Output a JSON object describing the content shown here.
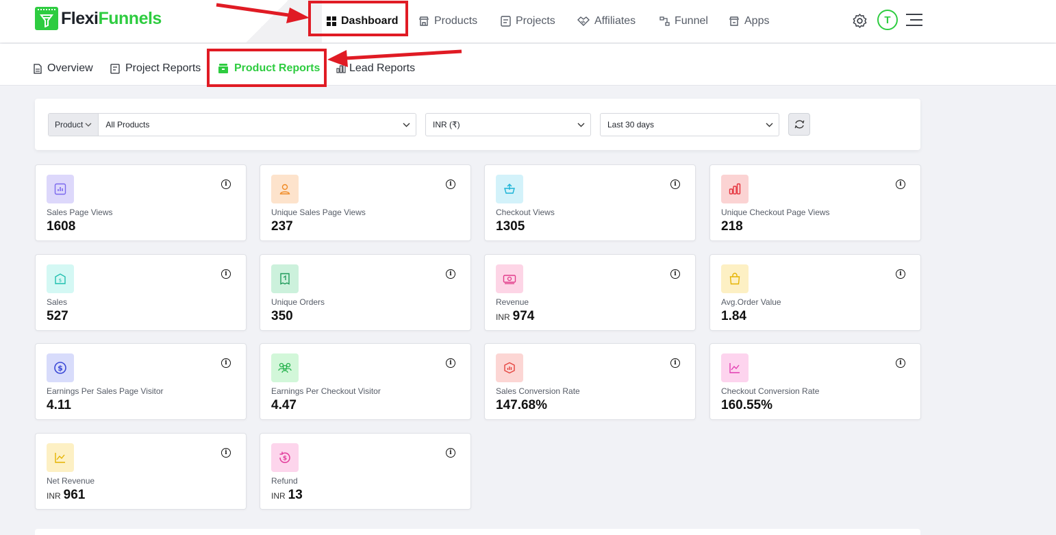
{
  "brand": {
    "name_part1": "Flexi",
    "name_part2": "Funnels"
  },
  "topnav": {
    "items": [
      {
        "label": "Dashboard",
        "icon": "grid-icon",
        "active": true
      },
      {
        "label": "Products",
        "icon": "store-icon"
      },
      {
        "label": "Projects",
        "icon": "document-icon"
      },
      {
        "label": "Affiliates",
        "icon": "handshake-icon"
      },
      {
        "label": "Funnel",
        "icon": "funnel-flow-icon"
      },
      {
        "label": "Apps",
        "icon": "apps-store-icon"
      }
    ],
    "avatar_initial": "T"
  },
  "subtabs": [
    {
      "label": "Overview",
      "icon": "file-icon"
    },
    {
      "label": "Project Reports",
      "icon": "report-icon"
    },
    {
      "label": "Product Reports",
      "icon": "product-box-icon",
      "active": true
    },
    {
      "label": "Lead Reports",
      "icon": "bar-chart-icon"
    }
  ],
  "filters": {
    "product_prefix": "Product",
    "product": "All Products",
    "currency": "INR (₹)",
    "date_range": "Last 30 days"
  },
  "metrics": [
    {
      "label": "Sales Page Views",
      "value": "1608",
      "icon": "chart-icon",
      "bg": "#ddd8fb",
      "fg": "#7b68ee"
    },
    {
      "label": "Unique Sales Page Views",
      "value": "237",
      "icon": "user-icon",
      "bg": "#fde3cc",
      "fg": "#f08a24"
    },
    {
      "label": "Checkout Views",
      "value": "1305",
      "icon": "basket-icon",
      "bg": "#d3f2fa",
      "fg": "#1bb3d6"
    },
    {
      "label": "Unique Checkout Page Views",
      "value": "218",
      "icon": "bars-icon",
      "bg": "#fbd3d3",
      "fg": "#e5323c"
    },
    {
      "label": "Sales",
      "value": "527",
      "icon": "money-bag-icon",
      "bg": "#d4f8f4",
      "fg": "#1fbfae"
    },
    {
      "label": "Unique Orders",
      "value": "350",
      "icon": "receipt-icon",
      "bg": "#ccf1dc",
      "fg": "#1e9a5a"
    },
    {
      "label": "Revenue",
      "value": "974",
      "currency": "INR",
      "icon": "cash-icon",
      "bg": "#fdd5e6",
      "fg": "#e23d8b"
    },
    {
      "label": "Avg.Order Value",
      "value": "1.84",
      "icon": "shopping-bag-icon",
      "bg": "#fdf0c4",
      "fg": "#e5b300"
    },
    {
      "label": "Earnings Per Sales Page Visitor",
      "value": "4.11",
      "icon": "dollar-circle-icon",
      "bg": "#d8dcfb",
      "fg": "#3a48d6"
    },
    {
      "label": "Earnings Per Checkout Visitor",
      "value": "4.47",
      "icon": "users-group-icon",
      "bg": "#d2f7d9",
      "fg": "#22b04a"
    },
    {
      "label": "Sales Conversion Rate",
      "value": "147.68%",
      "icon": "hexagon-chart-icon",
      "bg": "#fcd6d4",
      "fg": "#e5423c"
    },
    {
      "label": "Checkout Conversion Rate",
      "value": "160.55%",
      "icon": "line-chart-icon",
      "bg": "#fdd4ee",
      "fg": "#e23db1"
    },
    {
      "label": "Net Revenue",
      "value": "961",
      "currency": "INR",
      "icon": "trend-icon",
      "bg": "#fdf0c4",
      "fg": "#e5b300"
    },
    {
      "label": "Refund",
      "value": "13",
      "currency": "INR",
      "icon": "refund-icon",
      "bg": "#fdd5ec",
      "fg": "#e23d9b"
    }
  ],
  "annotation_color": "#e01b24",
  "accent_color": "#2ecc40"
}
